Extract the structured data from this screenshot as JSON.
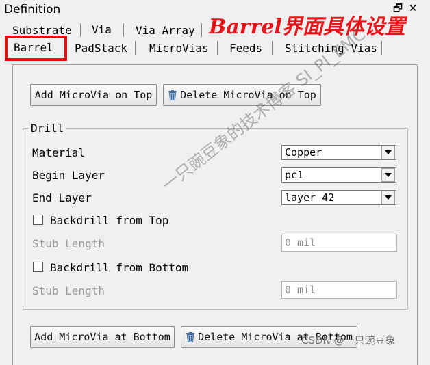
{
  "window": {
    "title": "Definition",
    "controls_glyph": "🗗 ✕"
  },
  "annotation": {
    "callout": "Barrel界面具体设置",
    "color": "#e8141a"
  },
  "tabs_row1": [
    "Substrate",
    "Via",
    "Via Array"
  ],
  "tabs_row2": [
    "Barrel",
    "PadStack",
    "MicroVias",
    "Feeds",
    "Stitching Vias"
  ],
  "active_tab": "Barrel",
  "buttons": {
    "add_top": "Add MicroVia on Top",
    "delete_top": "Delete MicroVia on Top",
    "add_bottom": "Add MicroVia at Bottom",
    "delete_bottom": "Delete MicroVia at Bottom"
  },
  "drill": {
    "group_label": "Drill",
    "material": {
      "label": "Material",
      "value": "Copper"
    },
    "begin_layer": {
      "label": "Begin Layer",
      "value": "pc1"
    },
    "end_layer": {
      "label": "End Layer",
      "value": "layer 42"
    },
    "backdrill_top": {
      "label": "Backdrill from Top",
      "checked": false
    },
    "stub_top": {
      "label": "Stub Length",
      "value": "0 mil"
    },
    "backdrill_bottom": {
      "label": "Backdrill from Bottom",
      "checked": false
    },
    "stub_bottom": {
      "label": "Stub Length",
      "value": "0 mil"
    }
  },
  "watermark": {
    "text": "一只豌豆象的技术博客 SI_PI_EMC"
  },
  "credit": "CSDN @一只豌豆象",
  "icons": {
    "trash": "trash-icon"
  }
}
